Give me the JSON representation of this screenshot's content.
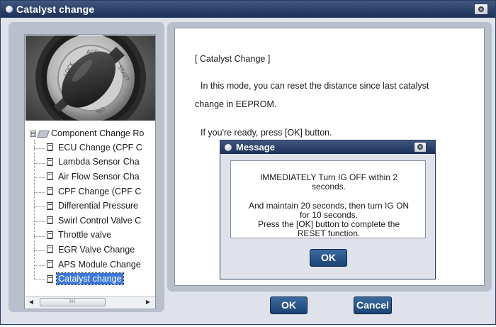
{
  "window": {
    "title": "Catalyst change"
  },
  "tree": {
    "root_label": "Component Change Ro",
    "root_expander": "⊟",
    "items": [
      {
        "label": "ECU Change (CPF C"
      },
      {
        "label": "Lambda Sensor Cha"
      },
      {
        "label": "Air Flow Sensor Cha"
      },
      {
        "label": "CPF Change (CPF C"
      },
      {
        "label": "Differential Pressure"
      },
      {
        "label": "Swirl Control Valve C"
      },
      {
        "label": "Throttle valve"
      },
      {
        "label": "EGR Valve Change"
      },
      {
        "label": "APS Module Change"
      },
      {
        "label": "Catalyst change",
        "selected": true
      }
    ],
    "scroll_left": "◀",
    "scroll_right": "▶",
    "scroll_thumb_grip": "III"
  },
  "photo": {
    "ring_labels": [
      "LOCK",
      "ACC",
      "START",
      "ON"
    ]
  },
  "info": {
    "heading": "[ Catalyst Change ]",
    "line1": "In this mode, you can reset the distance since last catalyst",
    "line2": "change in EEPROM.",
    "line3": "If you're ready, press [OK] button."
  },
  "buttons": {
    "ok": "OK",
    "cancel": "Cancel"
  },
  "dialog": {
    "title": "Message",
    "para1": "IMMEDIATELY Turn IG OFF within 2\nseconds.",
    "para2": "And maintain 20 seconds, then turn IG ON\nfor 10 seconds.\nPress the [OK] button to complete the\nRESET function.",
    "ok": "OK"
  },
  "icons": {
    "title_bullet": "bullet-icon",
    "camera": "camera-icon",
    "tree_folder": "folder-icon",
    "tree_doc": "document-icon"
  },
  "colors": {
    "titlebar": "#1b2f57",
    "button": "#1b4473",
    "selection": "#3c78d8"
  }
}
